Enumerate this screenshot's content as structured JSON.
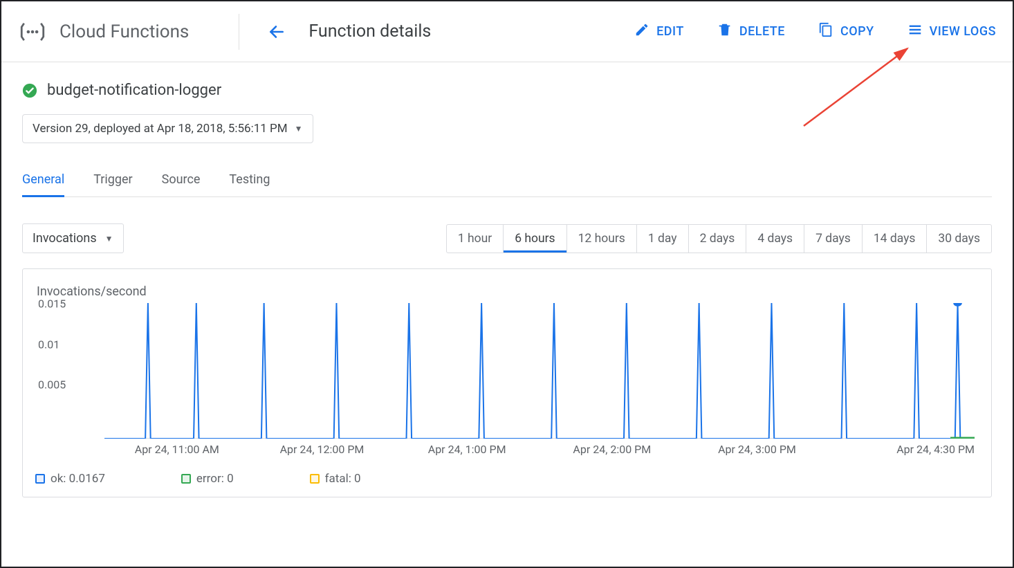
{
  "header": {
    "product": "Cloud Functions",
    "page_title": "Function details",
    "actions": {
      "edit": "EDIT",
      "delete": "DELETE",
      "copy": "COPY",
      "logs": "VIEW LOGS"
    }
  },
  "fn": {
    "name": "budget-notification-logger",
    "version_label": "Version 29, deployed at Apr 18, 2018, 5:56:11 PM"
  },
  "tabs": [
    "General",
    "Trigger",
    "Source",
    "Testing"
  ],
  "active_tab": "General",
  "metric_selector": "Invocations",
  "time_ranges": [
    "1 hour",
    "6 hours",
    "12 hours",
    "1 day",
    "2 days",
    "4 days",
    "7 days",
    "14 days",
    "30 days"
  ],
  "active_range": "6 hours",
  "chart_data": {
    "type": "line",
    "title": "Invocations/second",
    "ylabel": "",
    "xlabel": "",
    "ylim": [
      0,
      0.0167
    ],
    "y_ticks": [
      0.005,
      0.01,
      0.015
    ],
    "x_ticks": [
      "Apr 24, 11:00 AM",
      "Apr 24, 12:00 PM",
      "Apr 24, 1:00 PM",
      "Apr 24, 2:00 PM",
      "Apr 24, 3:00 PM",
      "Apr 24, 4:30 PM"
    ],
    "x_range_minutes": [
      630,
      990
    ],
    "series": [
      {
        "name": "ok",
        "color": "#1a73e8",
        "spike_times_min": [
          648,
          668,
          696,
          726,
          756,
          786,
          816,
          846,
          876,
          906,
          936,
          966,
          983
        ],
        "spike_value": 0.0167,
        "baseline": 0,
        "end_marker": true
      },
      {
        "name": "error",
        "color": "#34a853",
        "baseline": 0
      },
      {
        "name": "fatal",
        "color": "#fbbc04",
        "baseline": 0
      }
    ],
    "legend": [
      {
        "name": "ok",
        "value": "0.0167"
      },
      {
        "name": "error",
        "value": "0"
      },
      {
        "name": "fatal",
        "value": "0"
      }
    ]
  }
}
